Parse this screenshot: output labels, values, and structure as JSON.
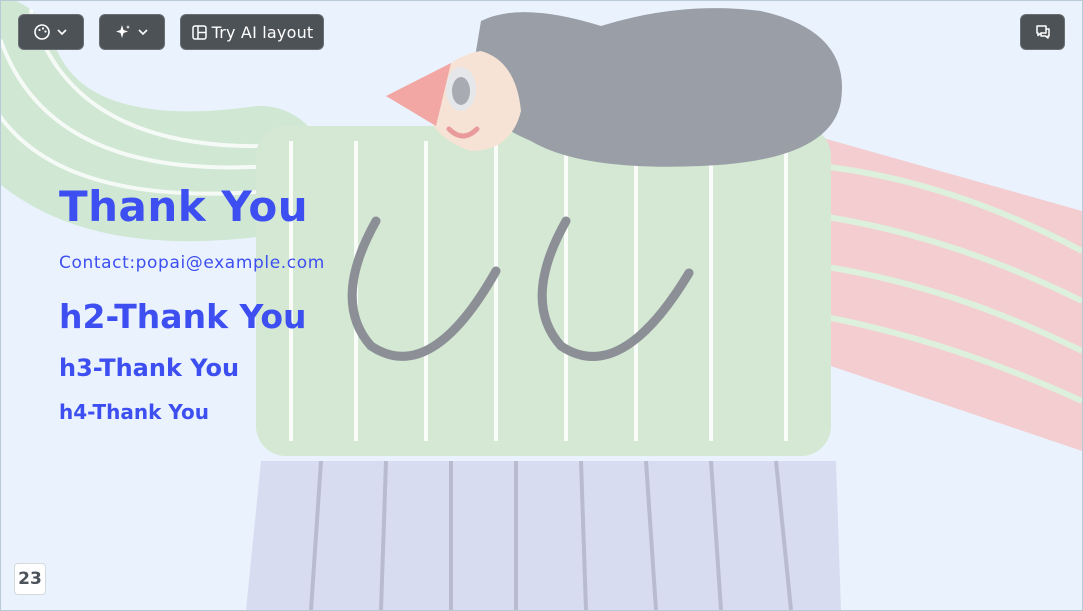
{
  "toolbar": {
    "theme_icon": "palette-icon",
    "ai_icon": "sparkles-icon",
    "layout_icon": "layout-icon",
    "layout_label": "Try AI layout",
    "chat_icon": "chat-icon"
  },
  "slide": {
    "title": "Thank You",
    "contact": "Contact:popai@example.com",
    "h2": "h2-Thank You",
    "h3": "h3-Thank You",
    "h4": "h4-Thank You",
    "page_number": "23"
  },
  "colors": {
    "heading": "#3d4ff0",
    "background": "#eaf3fd",
    "toolbar": "#4d5257"
  }
}
